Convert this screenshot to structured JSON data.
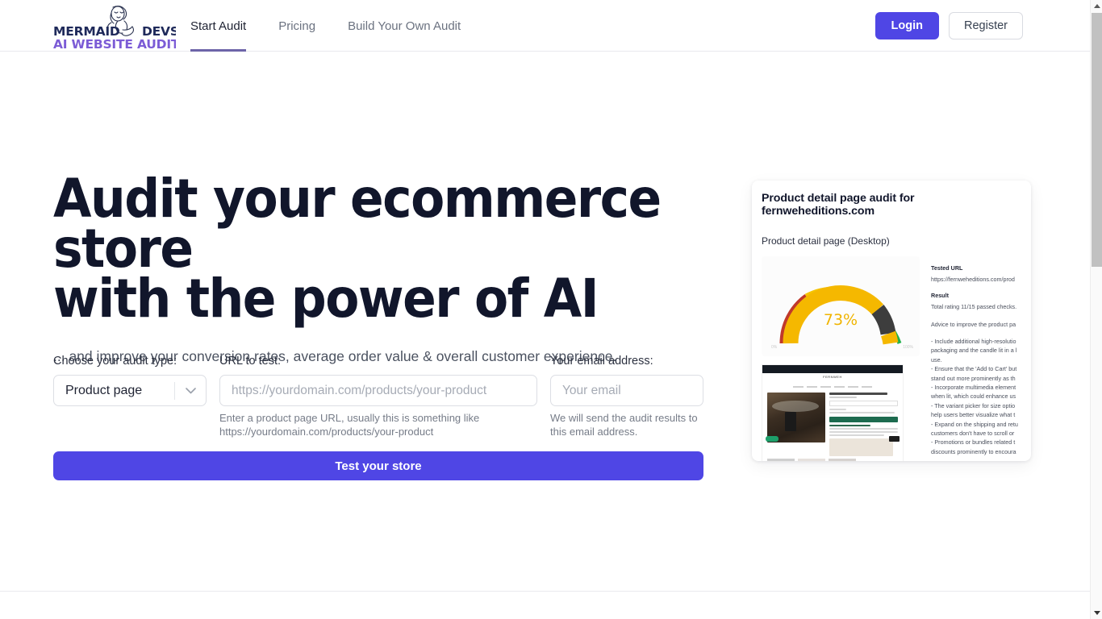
{
  "header": {
    "logo": {
      "word_left": "MERMAID",
      "word_right": "DEVS",
      "tagline": "AI WEBSITE AUDIT",
      "icon": "mermaid-icon",
      "color_dark": "#1f2a5a",
      "color_purple": "#7c5cd6"
    },
    "nav": [
      {
        "label": "Start Audit",
        "active": true
      },
      {
        "label": "Pricing",
        "active": false
      },
      {
        "label": "Build Your Own Audit",
        "active": false
      }
    ],
    "login_label": "Login",
    "register_label": "Register",
    "accent": "#4f46e5"
  },
  "hero": {
    "headline_line1": "Audit your ecommerce store",
    "headline_line2": "with the power of AI",
    "subheadline": "... and improve your conversion rates, average order value & overall customer experience."
  },
  "form": {
    "audit_type": {
      "label": "Choose your audit type:",
      "value": "Product page",
      "options": [
        "Product page"
      ],
      "chevron": "chevron-down-icon"
    },
    "url": {
      "label": "URL to test:",
      "value": "",
      "placeholder": "https://yourdomain.com/products/your-product",
      "help": "Enter a product page URL, usually this is something like https://yourdomain.com/products/your-product"
    },
    "email": {
      "label": "Your email address:",
      "value": "",
      "placeholder": "Your email",
      "help": "We will send the audit results to this email address."
    },
    "submit_label": "Test your store"
  },
  "preview": {
    "title": "Product detail page audit for fernweheditions.com",
    "subtitle": "Product detail page (Desktop)",
    "gauge": {
      "value_label": "73%",
      "value": 73,
      "min_label": "0%",
      "max_label": "100%",
      "value_color": "#f0b400",
      "segment_colors": [
        "#c0392b",
        "#f5c400",
        "#3d3d3d",
        "#22b14c"
      ]
    },
    "tested_url_heading": "Tested URL",
    "tested_url_value": "https://fernweheditions.com/prod",
    "result_heading": "Result",
    "result_value": "Total rating 11/15 passed checks.",
    "advice_intro": "Advice to improve the product pa",
    "advice_lines": [
      "- Include additional high-resolutio",
      "packaging and the candle lit in a l",
      "use.",
      "- Ensure that the 'Add to Cart' but",
      "stand out more prominently as th",
      "- Incorporate multimedia element",
      "when lit, which could enhance us",
      "- The variant picker for size optio",
      "help users better visualize what t",
      "- Expand on the shipping and retu",
      "customers don't have to scroll or",
      "- Promotions or bundles related t",
      "discounts prominently to encoura"
    ],
    "mini_site": {
      "brand": "FERNWEH",
      "cta_color": "#1d6b4f"
    }
  },
  "scrollbar": {
    "up_icon": "caret-up-icon",
    "down_icon": "caret-down-icon"
  }
}
